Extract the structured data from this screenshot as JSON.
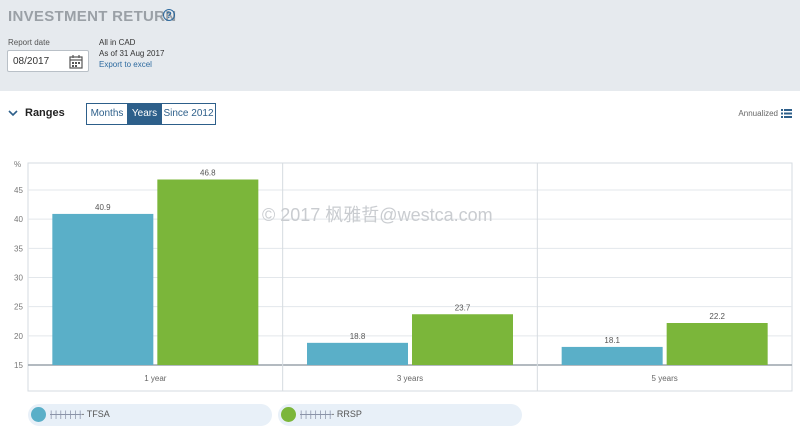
{
  "header": {
    "title": "INVESTMENT RETURN",
    "report_date_label": "Report date",
    "report_date_value": "08/2017",
    "currency_note": "All in CAD",
    "as_of": "As of 31 Aug 2017",
    "export_link": "Export to excel"
  },
  "ranges": {
    "label": "Ranges",
    "options": [
      "Months",
      "Years",
      "Since 2012"
    ],
    "selected": "Years",
    "annualized_label": "Annualized"
  },
  "watermark": "© 2017 枫雅哲@westca.com",
  "chart_data": {
    "type": "bar",
    "categories": [
      "1 year",
      "3 years",
      "5 years"
    ],
    "series": [
      {
        "name": "TFSA",
        "values": [
          40.9,
          18.8,
          18.1
        ],
        "color": "#5aafc8"
      },
      {
        "name": "RRSP",
        "values": [
          46.8,
          23.7,
          22.2
        ],
        "color": "#7bb63a"
      }
    ],
    "ylabel": "%",
    "yticks": [
      15,
      20,
      25,
      30,
      35,
      40,
      45
    ],
    "ylim": [
      15,
      50
    ],
    "grid": true
  },
  "legend": [
    {
      "prefix": "| | | | | | |",
      "name": "- TFSA"
    },
    {
      "prefix": "| | | | | | |",
      "name": "- RRSP"
    }
  ],
  "colors": {
    "accent": "#2d5f8a",
    "header_bg": "#e6eaee"
  }
}
